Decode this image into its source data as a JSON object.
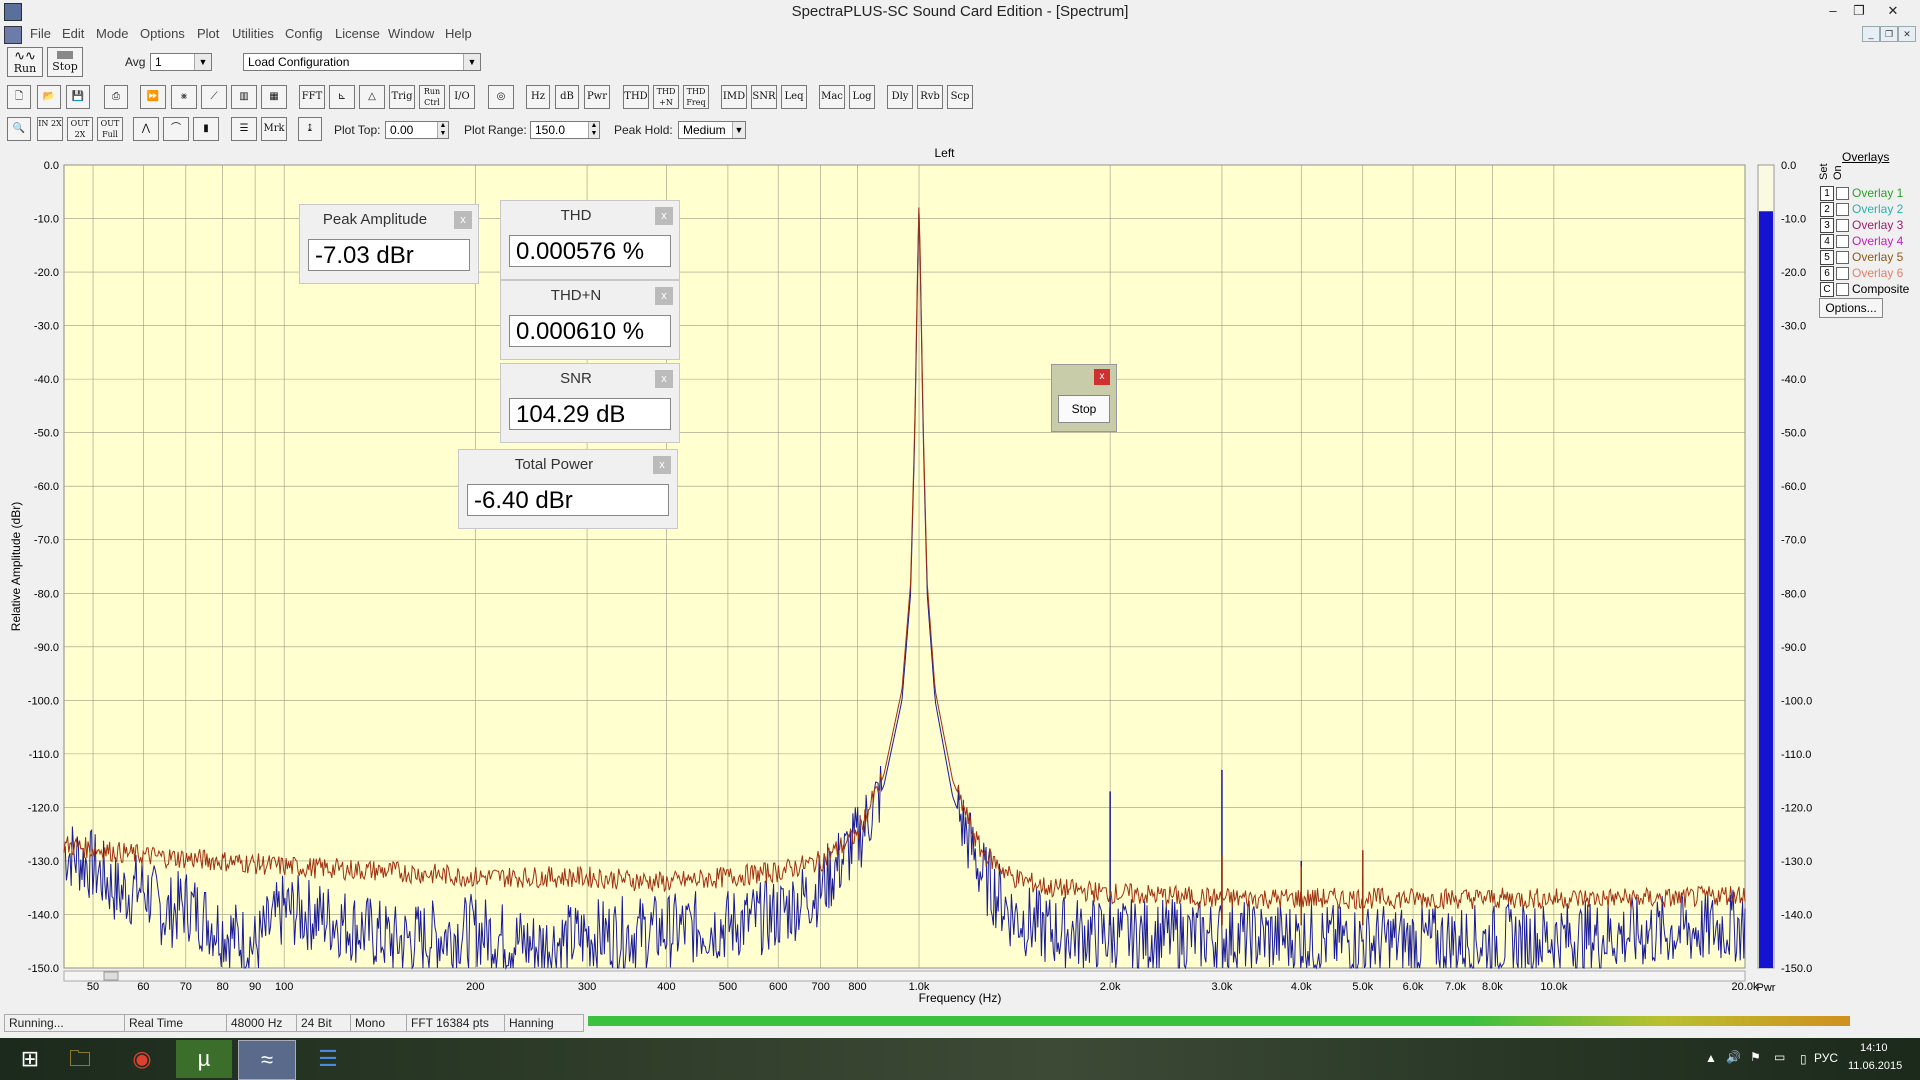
{
  "window": {
    "title": "SpectraPLUS-SC Sound Card Edition - [Spectrum]",
    "controls": [
      "–",
      "❐",
      "✕"
    ]
  },
  "menu": {
    "items": [
      "File",
      "Edit",
      "Mode",
      "Options",
      "Plot",
      "Utilities",
      "Config",
      "License",
      "Window",
      "Help"
    ],
    "mdi_controls": [
      "_",
      "❐",
      "✕"
    ]
  },
  "toolbar1": {
    "run_label": "Run",
    "stop_label": "Stop",
    "avg_label": "Avg",
    "avg_value": "1",
    "config_value": "Load Configuration"
  },
  "toolbar2": {
    "buttons": [
      "FFT",
      "Trig",
      "Run Ctrl",
      "I/O",
      "Hz",
      "dB",
      "Pwr",
      "THD",
      "THD +N",
      "THD Freq",
      "IMD",
      "SNR",
      "Leq",
      "Mac",
      "Log",
      "Dly",
      "Rvb",
      "Scp"
    ]
  },
  "toolbar3": {
    "buttons": [
      "IN 2X",
      "OUT 2X",
      "OUT Full",
      "Mrk"
    ],
    "plot_top_label": "Plot Top:",
    "plot_top_value": "0.00",
    "plot_range_label": "Plot Range:",
    "plot_range_value": "150.0",
    "peak_hold_label": "Peak Hold:",
    "peak_hold_value": "Medium"
  },
  "measurements": {
    "peak_amplitude": {
      "title": "Peak Amplitude",
      "value": "-7.03 dBr"
    },
    "thd": {
      "title": "THD",
      "value": "0.000576 %"
    },
    "thdn": {
      "title": "THD+N",
      "value": "0.000610 %"
    },
    "snr": {
      "title": "SNR",
      "value": "104.29 dB"
    },
    "total_power": {
      "title": "Total Power",
      "value": "-6.40 dBr"
    },
    "close_glyph": "x"
  },
  "stop_dialog": {
    "button": "Stop",
    "close_glyph": "x"
  },
  "overlays": {
    "header": "Overlays",
    "set_label": "Set",
    "on_label": "On",
    "items": [
      {
        "num": "1",
        "name": "Overlay 1",
        "color": "#2e9e2e"
      },
      {
        "num": "2",
        "name": "Overlay 2",
        "color": "#2ab0b0"
      },
      {
        "num": "3",
        "name": "Overlay 3",
        "color": "#a0206a"
      },
      {
        "num": "4",
        "name": "Overlay 4",
        "color": "#c020c0"
      },
      {
        "num": "5",
        "name": "Overlay 5",
        "color": "#8a5a1a"
      },
      {
        "num": "6",
        "name": "Overlay 6",
        "color": "#e0806a"
      },
      {
        "num": "C",
        "name": "Composite",
        "color": "#000000"
      }
    ],
    "options_button": "Options..."
  },
  "status": {
    "cells": [
      "Running...",
      "Real Time",
      "48000 Hz",
      "24 Bit",
      "Mono",
      "FFT 16384 pts",
      "Hanning"
    ]
  },
  "taskbar": {
    "lang": "РУС",
    "time": "14:10",
    "date": "11.06.2015"
  },
  "chart_data": {
    "type": "line",
    "title": "Left",
    "xlabel": "Frequency (Hz)",
    "ylabel": "Relative Amplitude (dBr)",
    "x_scale": "log",
    "xlim": [
      45,
      20000
    ],
    "ylim": [
      -150,
      0
    ],
    "x_ticks": [
      {
        "v": 50,
        "label": "50"
      },
      {
        "v": 60,
        "label": "60"
      },
      {
        "v": 70,
        "label": "70"
      },
      {
        "v": 80,
        "label": "80"
      },
      {
        "v": 90,
        "label": "90"
      },
      {
        "v": 100,
        "label": "100"
      },
      {
        "v": 200,
        "label": "200"
      },
      {
        "v": 300,
        "label": "300"
      },
      {
        "v": 400,
        "label": "400"
      },
      {
        "v": 500,
        "label": "500"
      },
      {
        "v": 600,
        "label": "600"
      },
      {
        "v": 700,
        "label": "700"
      },
      {
        "v": 800,
        "label": "800"
      },
      {
        "v": 1000,
        "label": "1.0k"
      },
      {
        "v": 2000,
        "label": "2.0k"
      },
      {
        "v": 3000,
        "label": "3.0k"
      },
      {
        "v": 4000,
        "label": "4.0k"
      },
      {
        "v": 5000,
        "label": "5.0k"
      },
      {
        "v": 6000,
        "label": "6.0k"
      },
      {
        "v": 7000,
        "label": "7.0k"
      },
      {
        "v": 8000,
        "label": "8.0k"
      },
      {
        "v": 10000,
        "label": "10.0k"
      },
      {
        "v": 20000,
        "label": "20.0k"
      }
    ],
    "y_ticks": [
      0,
      -10,
      -20,
      -30,
      -40,
      -50,
      -60,
      -70,
      -80,
      -90,
      -100,
      -110,
      -120,
      -130,
      -140,
      -150
    ],
    "y_tick_labels": [
      "0.0",
      "-10.0",
      "-20.0",
      "-30.0",
      "-40.0",
      "-50.0",
      "-60.0",
      "-70.0",
      "-80.0",
      "-90.0",
      "-100.0",
      "-110.0",
      "-120.0",
      "-130.0",
      "-140.0",
      "-150.0"
    ],
    "grid": true,
    "background": "#ffffd0",
    "series": [
      {
        "color": "#1a1a9a",
        "role": "spectrum",
        "points": [
          [
            45,
            -128
          ],
          [
            50,
            -131
          ],
          [
            55,
            -136
          ],
          [
            60,
            -135
          ],
          [
            65,
            -140
          ],
          [
            70,
            -138
          ],
          [
            80,
            -143
          ],
          [
            90,
            -146
          ],
          [
            100,
            -139
          ],
          [
            120,
            -141
          ],
          [
            150,
            -145
          ],
          [
            200,
            -143
          ],
          [
            250,
            -146
          ],
          [
            300,
            -144
          ],
          [
            400,
            -143
          ],
          [
            500,
            -142
          ],
          [
            600,
            -140
          ],
          [
            700,
            -135
          ],
          [
            800,
            -126
          ],
          [
            880,
            -116
          ],
          [
            940,
            -100
          ],
          [
            970,
            -80
          ],
          [
            985,
            -50
          ],
          [
            995,
            -20
          ],
          [
            1000,
            -7.03
          ],
          [
            1005,
            -20
          ],
          [
            1015,
            -50
          ],
          [
            1030,
            -80
          ],
          [
            1060,
            -100
          ],
          [
            1130,
            -118
          ],
          [
            1250,
            -132
          ],
          [
            1400,
            -140
          ],
          [
            1600,
            -143
          ],
          [
            2000,
            -144
          ],
          [
            3000,
            -144
          ],
          [
            5000,
            -145
          ],
          [
            8000,
            -145
          ],
          [
            12000,
            -144
          ],
          [
            16000,
            -143
          ],
          [
            20000,
            -142
          ]
        ],
        "harmonics": [
          [
            2000,
            -117
          ],
          [
            3000,
            -113
          ],
          [
            4000,
            -130
          ],
          [
            5000,
            -133
          ]
        ]
      },
      {
        "color": "#a03010",
        "role": "peak-hold",
        "points": [
          [
            45,
            -127
          ],
          [
            60,
            -129
          ],
          [
            80,
            -130
          ],
          [
            100,
            -131
          ],
          [
            150,
            -132
          ],
          [
            200,
            -133
          ],
          [
            300,
            -133
          ],
          [
            400,
            -134
          ],
          [
            500,
            -133
          ],
          [
            600,
            -132
          ],
          [
            700,
            -130
          ],
          [
            800,
            -125
          ],
          [
            880,
            -114
          ],
          [
            940,
            -98
          ],
          [
            970,
            -78
          ],
          [
            985,
            -48
          ],
          [
            995,
            -18
          ],
          [
            1000,
            -7
          ],
          [
            1005,
            -18
          ],
          [
            1015,
            -48
          ],
          [
            1030,
            -78
          ],
          [
            1060,
            -98
          ],
          [
            1130,
            -115
          ],
          [
            1250,
            -128
          ],
          [
            1400,
            -133
          ],
          [
            1600,
            -135
          ],
          [
            2000,
            -136
          ],
          [
            3000,
            -137
          ],
          [
            5000,
            -137
          ],
          [
            8000,
            -137
          ],
          [
            12000,
            -137
          ],
          [
            16000,
            -137
          ],
          [
            20000,
            -136
          ]
        ],
        "harmonics": [
          [
            3000,
            -129
          ],
          [
            4000,
            -131
          ],
          [
            5000,
            -128
          ]
        ]
      }
    ],
    "power_bar": {
      "label": "Pwr",
      "level_dBr": -6.4,
      "color": "#1414d0"
    }
  }
}
